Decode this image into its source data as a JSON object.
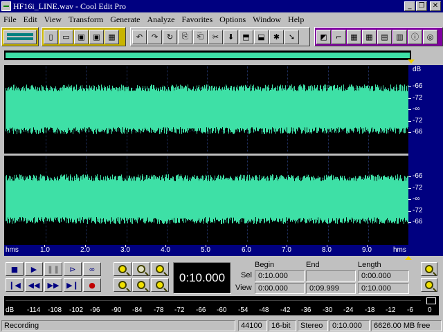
{
  "window": {
    "title": "HF16i_LINE.wav - Cool Edit Pro",
    "controls": {
      "minimize": "_",
      "restore": "❐",
      "close": "✕"
    }
  },
  "menu": [
    "File",
    "Edit",
    "View",
    "Transform",
    "Generate",
    "Analyze",
    "Favorites",
    "Options",
    "Window",
    "Help"
  ],
  "toolbar": {
    "accent_yellow": "#c8b400",
    "accent_purple": "#8000a0"
  },
  "waveform": {
    "color": "#3ee0a6",
    "background": "#000000",
    "channels": 2
  },
  "db_ruler": {
    "unit": "dB",
    "ch1": [
      "-66",
      "-72",
      "-∞",
      "-72",
      "-66"
    ],
    "ch2": [
      "-66",
      "-72",
      "-∞",
      "-72",
      "-66"
    ]
  },
  "time_ruler": {
    "start_label": "hms",
    "end_label": "hms",
    "ticks": [
      "1.0",
      "2.0",
      "3.0",
      "4.0",
      "5.0",
      "6.0",
      "7.0",
      "8.0",
      "9.0"
    ]
  },
  "transport": {
    "time": "0:10.000"
  },
  "selection": {
    "headers": {
      "begin": "Begin",
      "end": "End",
      "length": "Length"
    },
    "sel": {
      "label": "Sel",
      "begin": "0:10.000",
      "end": "",
      "length": "0:00.000"
    },
    "view": {
      "label": "View",
      "begin": "0:00.000",
      "end": "0:09.999",
      "length": "0:10.000"
    }
  },
  "level_meter": {
    "labels": [
      "dB",
      "-114",
      "-108",
      "-102",
      "-96",
      "-90",
      "-84",
      "-78",
      "-72",
      "-66",
      "-60",
      "-54",
      "-48",
      "-42",
      "-36",
      "-30",
      "-24",
      "-18",
      "-12",
      "-6",
      "0"
    ]
  },
  "status": {
    "state": "Recording",
    "sample_rate": "44100",
    "bit_depth": "16-bit",
    "channels": "Stereo",
    "length": "0:10.000",
    "free_space": "6626.00 MB free"
  }
}
